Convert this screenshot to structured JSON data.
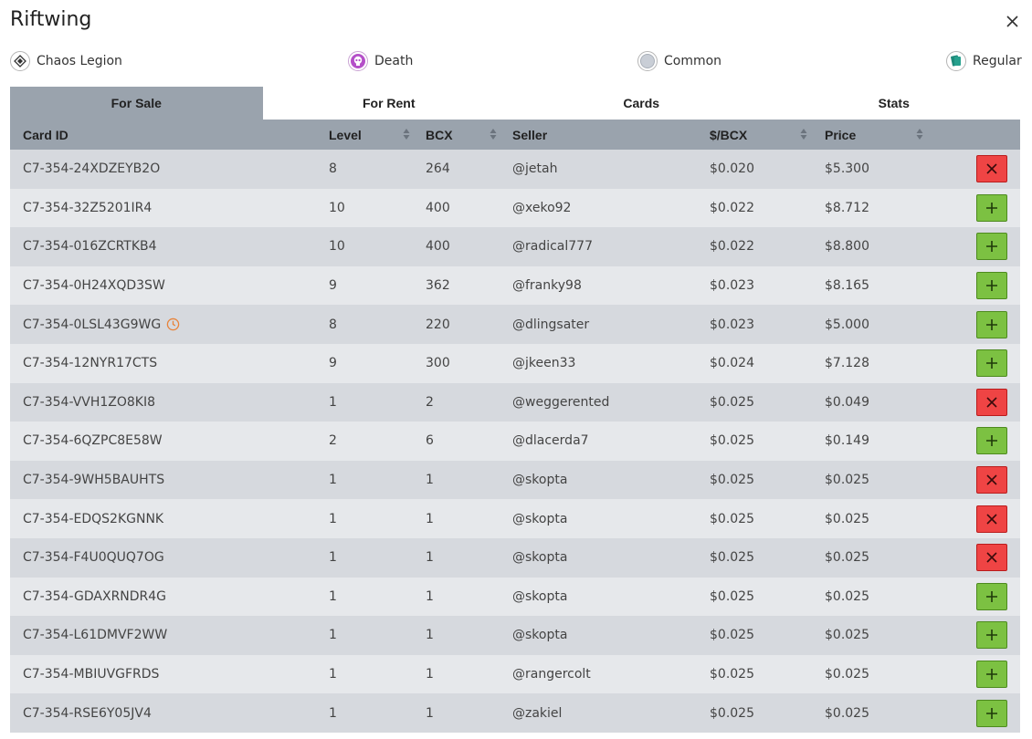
{
  "title": "Riftwing",
  "attributes": [
    {
      "label": "Chaos Legion",
      "icon": "chaos-legion-icon"
    },
    {
      "label": "Death",
      "icon": "death-skull-icon"
    },
    {
      "label": "Common",
      "icon": "common-rarity-icon"
    },
    {
      "label": "Regular",
      "icon": "regular-card-icon"
    }
  ],
  "tabs": [
    {
      "label": "For Sale",
      "active": true
    },
    {
      "label": "For Rent",
      "active": false
    },
    {
      "label": "Cards",
      "active": false
    },
    {
      "label": "Stats",
      "active": false
    }
  ],
  "columns": {
    "card_id": "Card ID",
    "level": "Level",
    "bcx": "BCX",
    "seller": "Seller",
    "per_bcx": "$/BCX",
    "price": "Price"
  },
  "rows": [
    {
      "card_id": "C7-354-24XDZEYB2O",
      "level": "8",
      "bcx": "264",
      "seller": "@jetah",
      "per_bcx": "$0.020",
      "price": "$5.300",
      "action": "remove",
      "pending": false
    },
    {
      "card_id": "C7-354-32Z5201IR4",
      "level": "10",
      "bcx": "400",
      "seller": "@xeko92",
      "per_bcx": "$0.022",
      "price": "$8.712",
      "action": "add",
      "pending": false
    },
    {
      "card_id": "C7-354-016ZCRTKB4",
      "level": "10",
      "bcx": "400",
      "seller": "@radical777",
      "per_bcx": "$0.022",
      "price": "$8.800",
      "action": "add",
      "pending": false
    },
    {
      "card_id": "C7-354-0H24XQD3SW",
      "level": "9",
      "bcx": "362",
      "seller": "@franky98",
      "per_bcx": "$0.023",
      "price": "$8.165",
      "action": "add",
      "pending": false
    },
    {
      "card_id": "C7-354-0LSL43G9WG",
      "level": "8",
      "bcx": "220",
      "seller": "@dlingsater",
      "per_bcx": "$0.023",
      "price": "$5.000",
      "action": "add",
      "pending": true
    },
    {
      "card_id": "C7-354-12NYR17CTS",
      "level": "9",
      "bcx": "300",
      "seller": "@jkeen33",
      "per_bcx": "$0.024",
      "price": "$7.128",
      "action": "add",
      "pending": false
    },
    {
      "card_id": "C7-354-VVH1ZO8KI8",
      "level": "1",
      "bcx": "2",
      "seller": "@weggerented",
      "per_bcx": "$0.025",
      "price": "$0.049",
      "action": "remove",
      "pending": false
    },
    {
      "card_id": "C7-354-6QZPC8E58W",
      "level": "2",
      "bcx": "6",
      "seller": "@dlacerda7",
      "per_bcx": "$0.025",
      "price": "$0.149",
      "action": "add",
      "pending": false
    },
    {
      "card_id": "C7-354-9WH5BAUHTS",
      "level": "1",
      "bcx": "1",
      "seller": "@skopta",
      "per_bcx": "$0.025",
      "price": "$0.025",
      "action": "remove",
      "pending": false
    },
    {
      "card_id": "C7-354-EDQS2KGNNK",
      "level": "1",
      "bcx": "1",
      "seller": "@skopta",
      "per_bcx": "$0.025",
      "price": "$0.025",
      "action": "remove",
      "pending": false
    },
    {
      "card_id": "C7-354-F4U0QUQ7OG",
      "level": "1",
      "bcx": "1",
      "seller": "@skopta",
      "per_bcx": "$0.025",
      "price": "$0.025",
      "action": "remove",
      "pending": false
    },
    {
      "card_id": "C7-354-GDAXRNDR4G",
      "level": "1",
      "bcx": "1",
      "seller": "@skopta",
      "per_bcx": "$0.025",
      "price": "$0.025",
      "action": "add",
      "pending": false
    },
    {
      "card_id": "C7-354-L61DMVF2WW",
      "level": "1",
      "bcx": "1",
      "seller": "@skopta",
      "per_bcx": "$0.025",
      "price": "$0.025",
      "action": "add",
      "pending": false
    },
    {
      "card_id": "C7-354-MBIUVGFRDS",
      "level": "1",
      "bcx": "1",
      "seller": "@rangercolt",
      "per_bcx": "$0.025",
      "price": "$0.025",
      "action": "add",
      "pending": false
    },
    {
      "card_id": "C7-354-RSE6Y05JV4",
      "level": "1",
      "bcx": "1",
      "seller": "@zakiel",
      "per_bcx": "$0.025",
      "price": "$0.025",
      "action": "add",
      "pending": false
    }
  ],
  "colors": {
    "header_bg": "#9aa3ad",
    "row_odd": "#d6d9de",
    "row_even": "#e6e8eb",
    "remove": "#ef4444",
    "add": "#7cc142",
    "pending_clock": "#e8833a",
    "death_purple": "#b44fc8",
    "regular_teal": "#1e8a7a"
  }
}
